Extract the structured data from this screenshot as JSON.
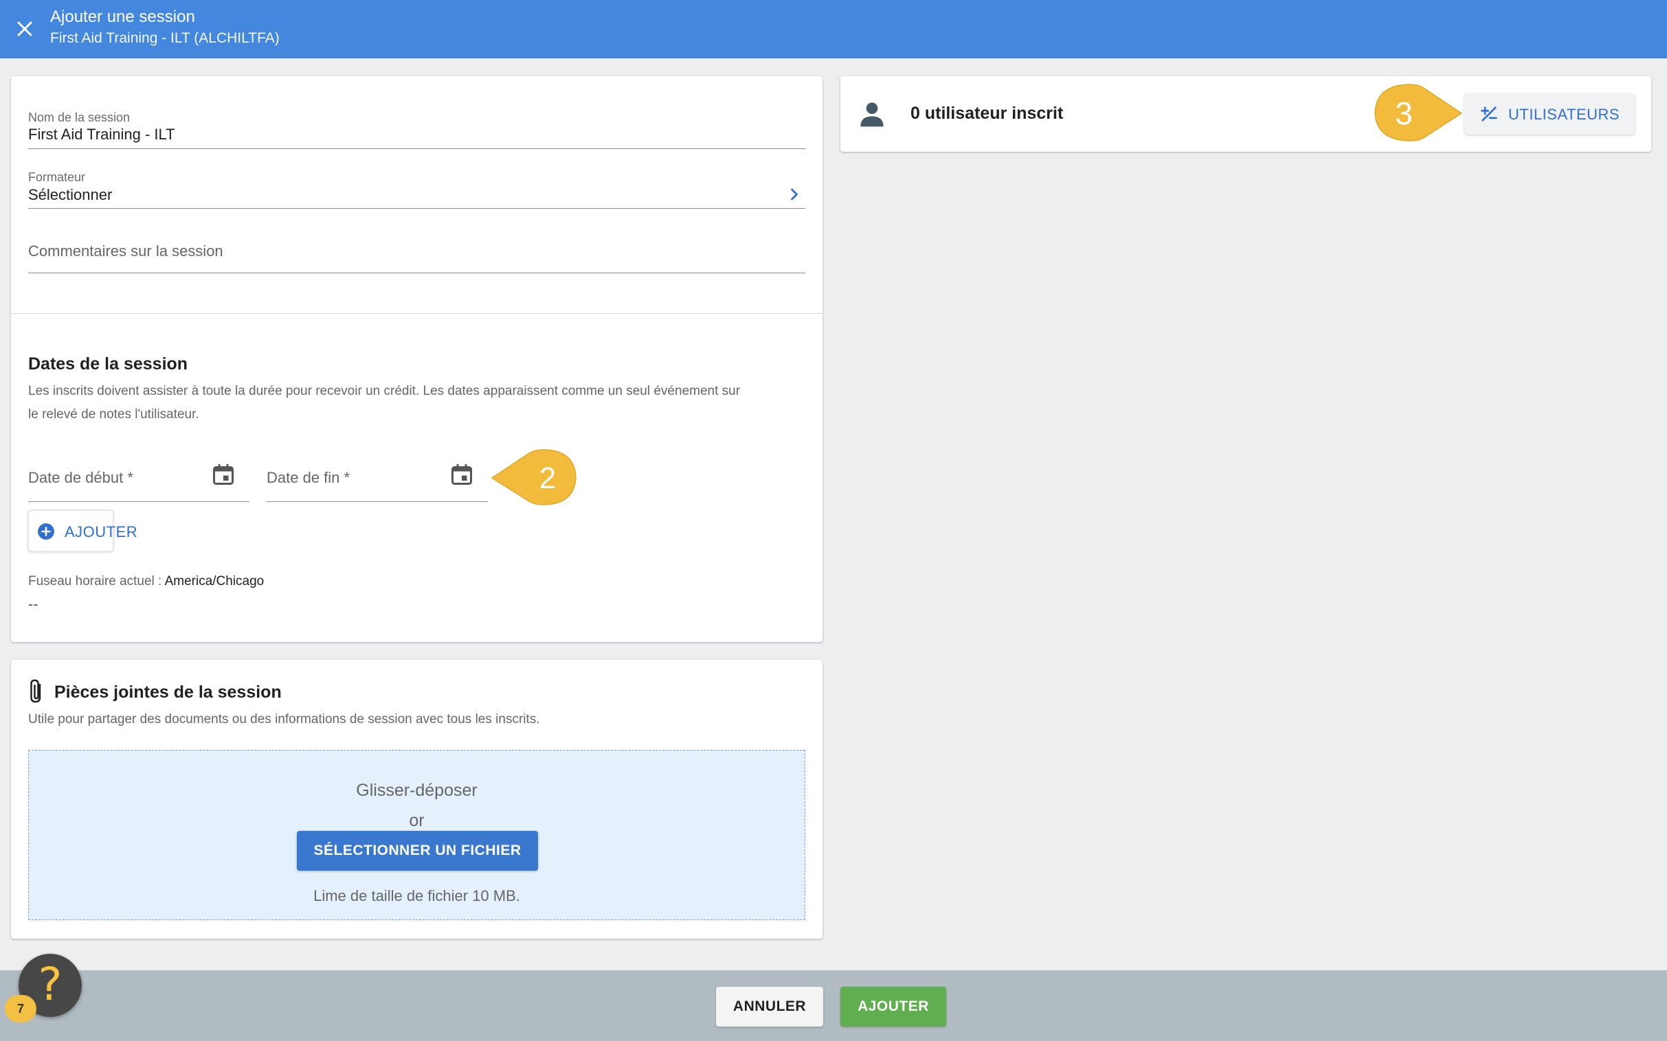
{
  "header": {
    "title": "Ajouter une session",
    "subtitle": "First Aid Training - ILT (ALCHILTFA)"
  },
  "form": {
    "session_name_label": "Nom de la session",
    "session_name_value": "First Aid Training - ILT",
    "trainer_label": "Formateur",
    "trainer_value": "Sélectionner",
    "comments_placeholder": "Commentaires sur la session"
  },
  "dates": {
    "title": "Dates de la session",
    "help_line1": "Les inscrits doivent assister à toute la durée pour recevoir un crédit. Les dates apparaissent comme un seul événement sur",
    "help_line2": "le relevé de notes l'utilisateur.",
    "start_label": "Date de début *",
    "end_label": "Date de fin *",
    "add_label": "AJOUTER",
    "timezone_label": "Fuseau horaire actuel :",
    "timezone_value": "America/Chicago",
    "timezone_dash": "--"
  },
  "attachments": {
    "title": "Pièces jointes de la session",
    "help": "Utile pour partager des documents ou des informations de session avec tous les inscrits.",
    "drop_title": "Glisser-déposer",
    "drop_or": "or",
    "select_button": "SÉLECTIONNER UN FICHIER",
    "size_limit": "Lime de taille de fichier 10 MB."
  },
  "users": {
    "count_text": "0 utilisateur inscrit",
    "button_label": "UTILISATEURS"
  },
  "markers": {
    "step2": "2",
    "step3": "3"
  },
  "footer": {
    "cancel_label": "ANNULER",
    "add_label": "AJOUTER"
  },
  "help_widget": {
    "icon": "?",
    "badge_count": "7"
  },
  "colors": {
    "header_bg": "#4387de",
    "accent_blue": "#2f6fcf",
    "add_green": "#5fae4f",
    "marker_yellow": "#f2bb3c",
    "footer_bg": "#b1bcc2"
  }
}
